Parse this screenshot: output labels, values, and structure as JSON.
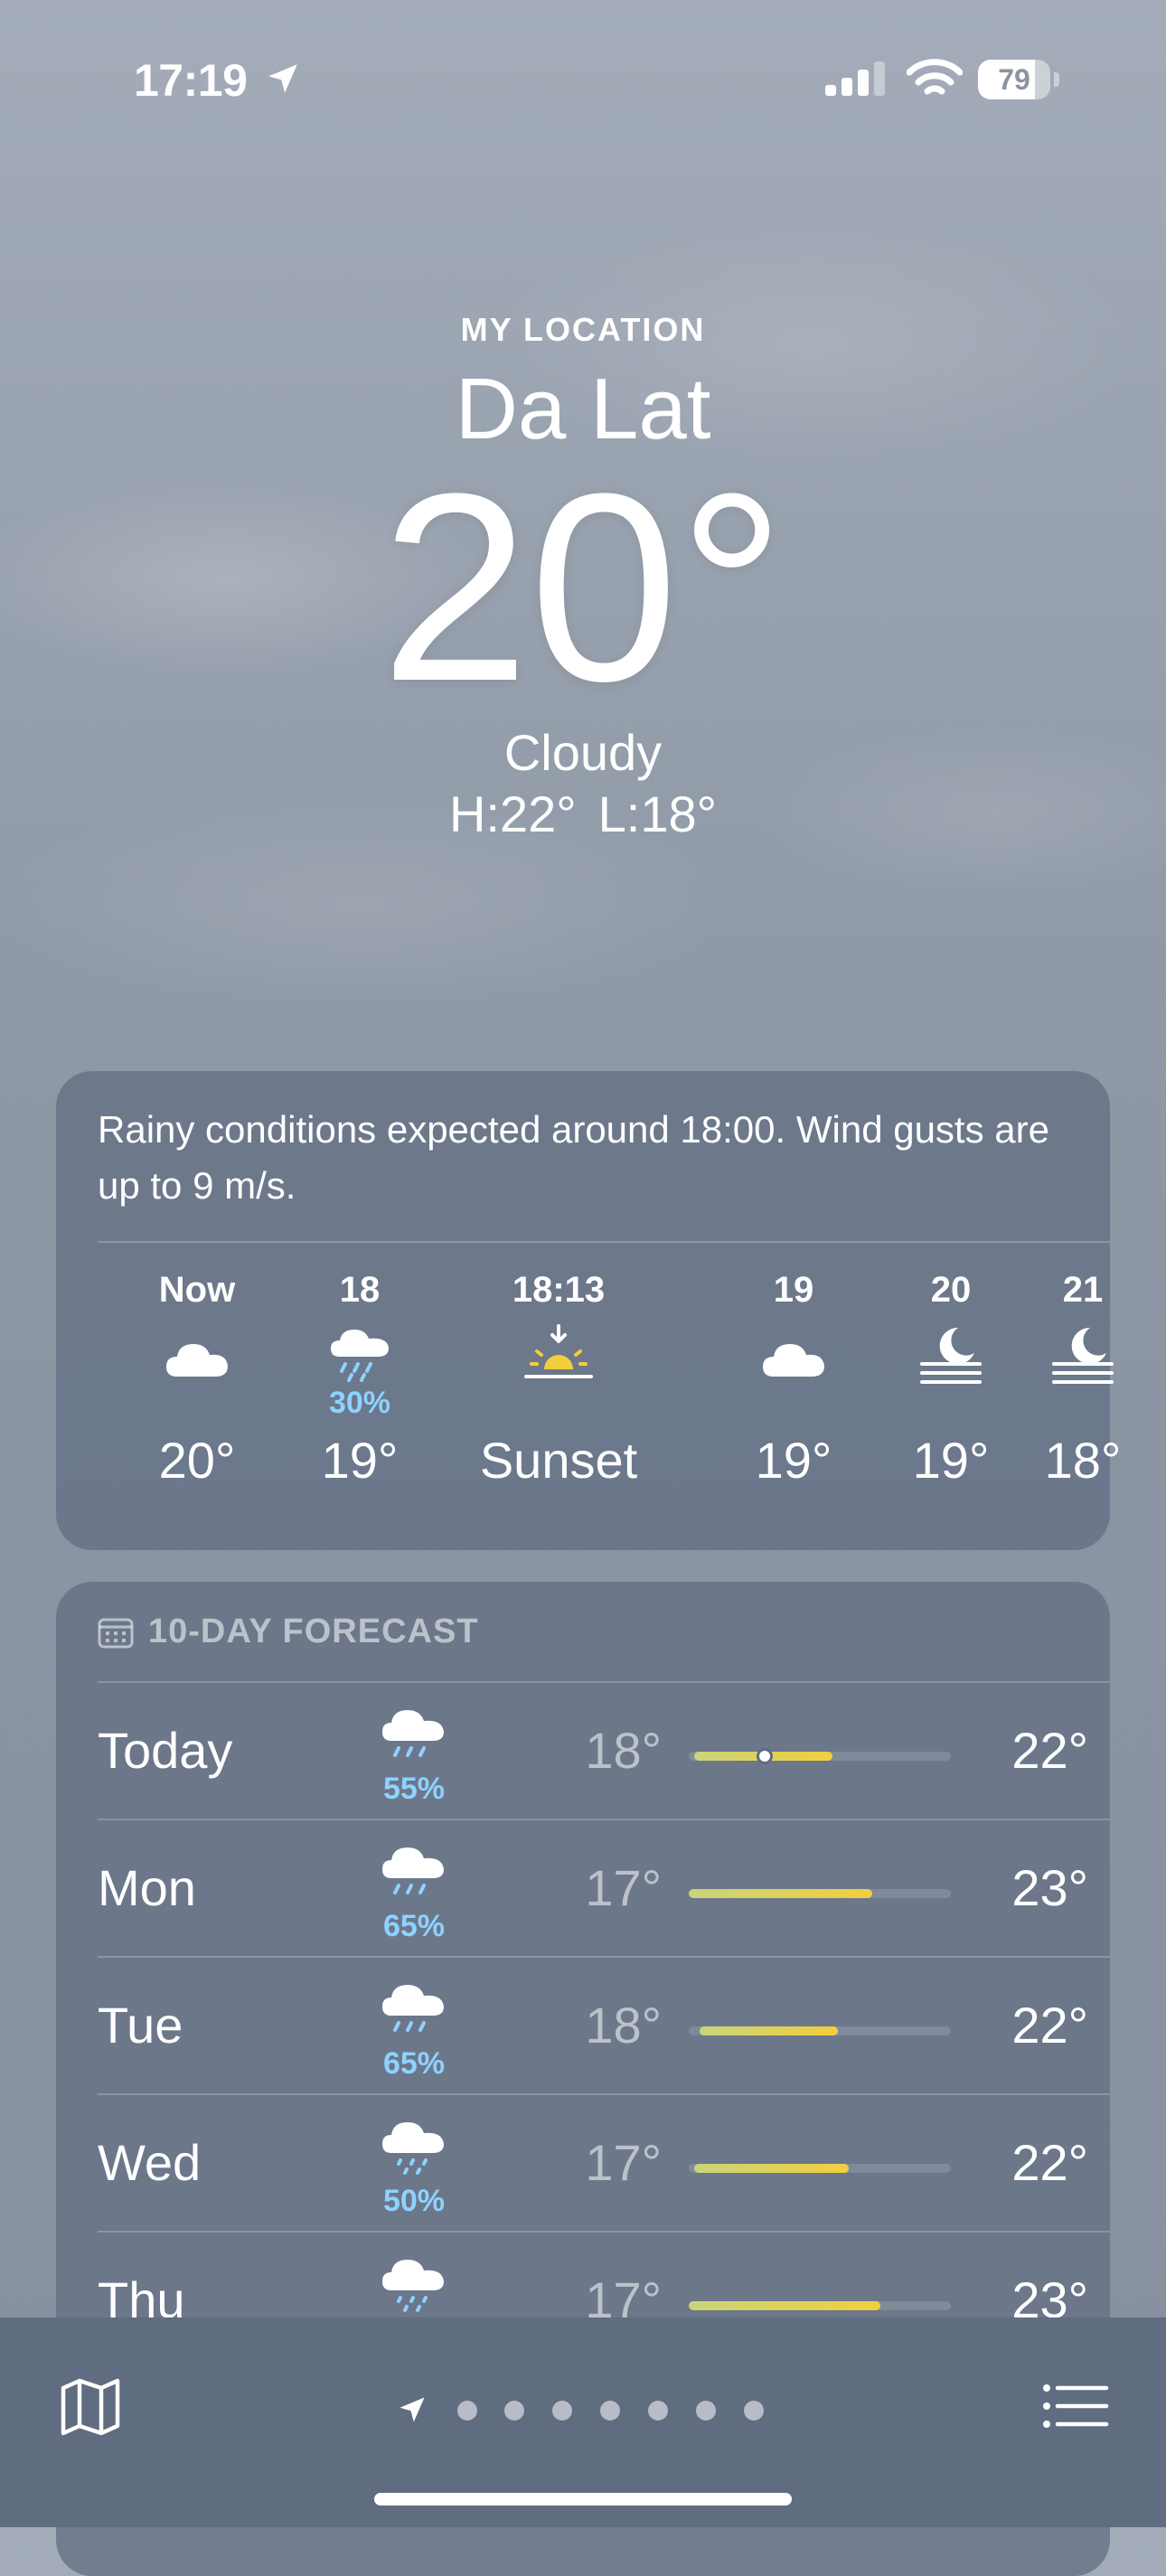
{
  "status_bar": {
    "time": "17:19",
    "battery": "79",
    "battery_level": 0.79
  },
  "header": {
    "my_location": "MY LOCATION",
    "city": "Da Lat",
    "temperature": "20°",
    "condition": "Cloudy",
    "high": "H:22°",
    "low": "L:18°"
  },
  "hourly": {
    "summary": "Rainy conditions expected around 18:00. Wind gusts are up to 9 m/s.",
    "hours": [
      {
        "label": "Now",
        "icon": "cloud-icon",
        "precip": "",
        "temp": "20°"
      },
      {
        "label": "18",
        "icon": "cloud-rain-icon",
        "precip": "30%",
        "temp": "19°"
      },
      {
        "label": "18:13",
        "icon": "sunset-icon",
        "precip": "",
        "temp": "Sunset"
      },
      {
        "label": "19",
        "icon": "cloud-icon",
        "precip": "",
        "temp": "19°"
      },
      {
        "label": "20",
        "icon": "moon-fog-icon",
        "precip": "",
        "temp": "19°"
      },
      {
        "label": "21",
        "icon": "moon-fog-icon",
        "precip": "",
        "temp": "18°"
      }
    ]
  },
  "forecast": {
    "title": "10-DAY FORECAST",
    "days": [
      {
        "day": "Today",
        "icon": "cloud-rain-icon",
        "precip": "55%",
        "low": "18°",
        "high": "22°",
        "bar_start": 0.02,
        "bar_end": 0.55,
        "current": 0.29
      },
      {
        "day": "Mon",
        "icon": "cloud-rain-icon",
        "precip": "65%",
        "low": "17°",
        "high": "23°",
        "bar_start": 0.0,
        "bar_end": 0.7
      },
      {
        "day": "Tue",
        "icon": "cloud-rain-icon",
        "precip": "65%",
        "low": "18°",
        "high": "22°",
        "bar_start": 0.04,
        "bar_end": 0.57
      },
      {
        "day": "Wed",
        "icon": "cloud-drizzle-icon",
        "precip": "50%",
        "low": "17°",
        "high": "22°",
        "bar_start": 0.02,
        "bar_end": 0.61
      },
      {
        "day": "Thu",
        "icon": "cloud-drizzle-icon",
        "precip": "",
        "low": "17°",
        "high": "23°",
        "bar_start": 0.0,
        "bar_end": 0.73
      }
    ]
  },
  "bottom_bar": {
    "page_count": 7
  }
}
